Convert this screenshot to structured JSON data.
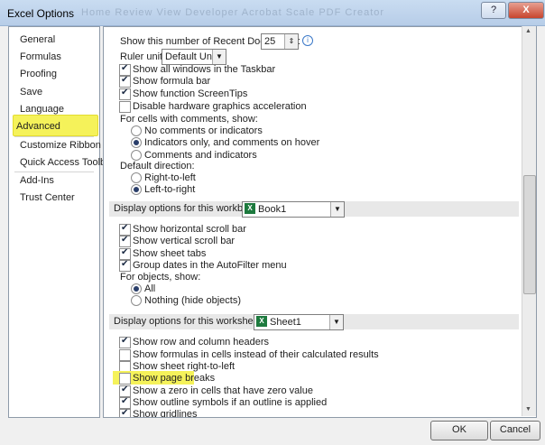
{
  "window": {
    "title": "Excel Options",
    "ghost_title": "Home   Review   View   Developer   Acrobat   Scale PDF Creator",
    "help": "?",
    "close": "X"
  },
  "nav": {
    "items": [
      {
        "label": "General"
      },
      {
        "label": "Formulas"
      },
      {
        "label": "Proofing"
      },
      {
        "label": "Save"
      },
      {
        "label": "Language"
      },
      {
        "label": "Advanced",
        "selected": true
      },
      {
        "label": "Customize Ribbon"
      },
      {
        "label": "Quick Access Toolbar"
      },
      {
        "label": "Add-Ins"
      },
      {
        "label": "Trust Center"
      }
    ]
  },
  "display": {
    "recent_docs_label": "Show this number of Recent Documents:",
    "recent_docs_value": "25",
    "ruler_label": "Ruler units",
    "ruler_value": "Default Units",
    "show_all_windows": "Show all windows in the Taskbar",
    "show_formula_bar": "Show formula bar",
    "show_function_tips": "Show function ScreenTips",
    "disable_hw_accel": "Disable hardware graphics acceleration",
    "comments_header": "For cells with comments, show:",
    "no_comments": "No comments or indicators",
    "indicators_only": "Indicators only, and comments on hover",
    "comments_indicators": "Comments and indicators",
    "direction_header": "Default direction:",
    "rtl": "Right-to-left",
    "ltr": "Left-to-right"
  },
  "workbook": {
    "section_title": "Display options for this workbook:",
    "selected": "Book1",
    "h_scroll": "Show horizontal scroll bar",
    "v_scroll": "Show vertical scroll bar",
    "sheet_tabs": "Show sheet tabs",
    "group_dates": "Group dates in the AutoFilter menu",
    "objects_header": "For objects, show:",
    "all": "All",
    "nothing": "Nothing (hide objects)"
  },
  "worksheet": {
    "section_title": "Display options for this worksheet:",
    "selected": "Sheet1",
    "row_col_headers": "Show row and column headers",
    "formulas": "Show formulas in cells instead of their calculated results",
    "rtl": "Show sheet right-to-left",
    "page_breaks": "Show page breaks",
    "zero": "Show a zero in cells that have zero value",
    "outline": "Show outline symbols if an outline is applied",
    "gridlines": "Show gridlines"
  },
  "footer": {
    "ok": "OK",
    "cancel": "Cancel"
  },
  "colors": {
    "highlight": "#f5f25a"
  }
}
